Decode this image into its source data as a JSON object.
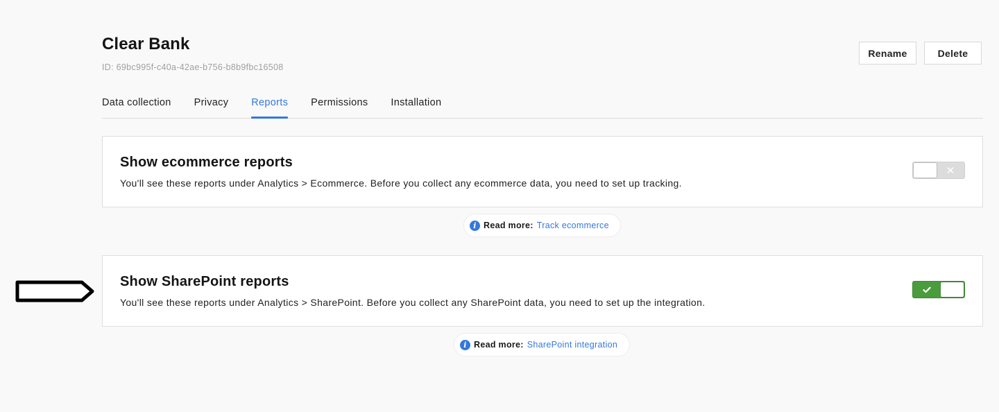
{
  "header": {
    "title": "Clear Bank",
    "id_text": "ID: 69bc995f-c40a-42ae-b756-b8b9fbc16508",
    "rename_label": "Rename",
    "delete_label": "Delete"
  },
  "tabs": [
    {
      "label": "Data collection",
      "active": false
    },
    {
      "label": "Privacy",
      "active": false
    },
    {
      "label": "Reports",
      "active": true
    },
    {
      "label": "Permissions",
      "active": false
    },
    {
      "label": "Installation",
      "active": false
    }
  ],
  "settings": [
    {
      "title": "Show ecommerce reports",
      "description": "You'll see these reports under Analytics > Ecommerce. Before you collect any ecommerce data, you need to set up tracking.",
      "enabled": false,
      "toggle_glyph": "✕",
      "read_more_label": "Read more:",
      "read_more_link": "Track ecommerce"
    },
    {
      "title": "Show SharePoint reports",
      "description": "You'll see these reports under Analytics > SharePoint. Before you collect any SharePoint data, you need to set up the integration.",
      "enabled": true,
      "toggle_glyph": "✓",
      "read_more_label": "Read more:",
      "read_more_link": "SharePoint integration"
    }
  ],
  "colors": {
    "accent": "#3478dc",
    "toggle_on": "#4a9c3c",
    "toggle_off": "#dcdcdc",
    "background": "#f9f9f9"
  }
}
